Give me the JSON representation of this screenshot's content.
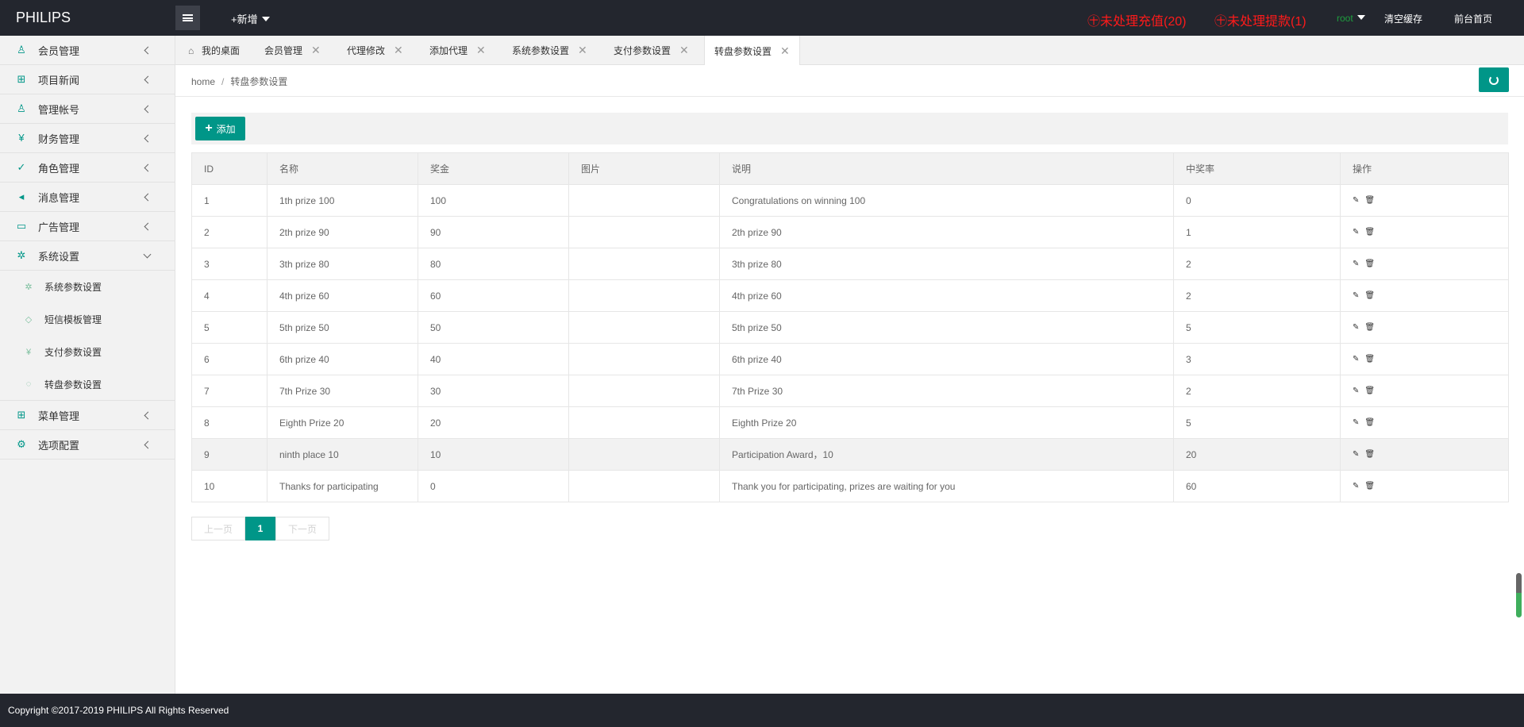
{
  "header": {
    "logo": "PHILIPS",
    "add_new": "+新增",
    "alert_recharge": "㊉未处理充值(20)",
    "alert_withdraw": "㊉未处理提款(1)",
    "user": "root",
    "clear_cache": "清空缓存",
    "front_home": "前台首页"
  },
  "sidebar": {
    "items": [
      {
        "label": "会员管理",
        "icon": "user-icon"
      },
      {
        "label": "项目新闻",
        "icon": "book-icon"
      },
      {
        "label": "管理帐号",
        "icon": "admin-icon"
      },
      {
        "label": "财务管理",
        "icon": "yen-icon"
      },
      {
        "label": "角色管理",
        "icon": "shield-icon"
      },
      {
        "label": "消息管理",
        "icon": "speaker-icon"
      },
      {
        "label": "广告管理",
        "icon": "image-icon"
      },
      {
        "label": "系统设置",
        "icon": "gear-icon"
      },
      {
        "label": "菜单管理",
        "icon": "grid-icon"
      },
      {
        "label": "选项配置",
        "icon": "settings-icon"
      }
    ],
    "sub_items": [
      {
        "label": "系统参数设置",
        "icon": "gear-icon"
      },
      {
        "label": "短信模板管理",
        "icon": "tag-icon"
      },
      {
        "label": "支付参数设置",
        "icon": "yen-icon"
      },
      {
        "label": "转盘参数设置",
        "icon": "wheel-icon"
      }
    ]
  },
  "tabs": [
    {
      "label": "我的桌面"
    },
    {
      "label": "会员管理"
    },
    {
      "label": "代理修改"
    },
    {
      "label": "添加代理"
    },
    {
      "label": "系统参数设置"
    },
    {
      "label": "支付参数设置"
    },
    {
      "label": "转盘参数设置"
    }
  ],
  "breadcrumb": {
    "home": "home",
    "sep": "/",
    "current": "转盘参数设置"
  },
  "toolbar": {
    "add_label": "添加"
  },
  "table": {
    "columns": [
      "ID",
      "名称",
      "奖金",
      "图片",
      "说明",
      "中奖率",
      "操作"
    ],
    "rows": [
      [
        "1",
        "1th prize 100",
        "100",
        "",
        "Congratulations on winning 100",
        "0"
      ],
      [
        "2",
        "2th prize 90",
        "90",
        "",
        "2th prize 90",
        "1"
      ],
      [
        "3",
        "3th prize 80",
        "80",
        "",
        "3th prize 80",
        "2"
      ],
      [
        "4",
        "4th prize 60",
        "60",
        "",
        "4th prize 60",
        "2"
      ],
      [
        "5",
        "5th prize 50",
        "50",
        "",
        "5th prize 50",
        "5"
      ],
      [
        "6",
        "6th prize 40",
        "40",
        "",
        "6th prize 40",
        "3"
      ],
      [
        "7",
        "7th Prize 30",
        "30",
        "",
        "7th Prize 30",
        "2"
      ],
      [
        "8",
        "Eighth Prize 20",
        "20",
        "",
        "Eighth Prize 20",
        "5"
      ],
      [
        "9",
        "ninth place 10",
        "10",
        "",
        "Participation Award，10",
        "20"
      ],
      [
        "10",
        "Thanks for participating",
        "0",
        "",
        "Thank you for participating, prizes are waiting for you",
        "60"
      ]
    ]
  },
  "pager": {
    "prev": "上一页",
    "current": "1",
    "next": "下一页"
  },
  "footer": "Copyright ©2017-2019 PHILIPS All Rights Reserved",
  "colors": {
    "accent": "#009688",
    "header_bg": "#23262e",
    "alert": "#ff1a1a"
  }
}
